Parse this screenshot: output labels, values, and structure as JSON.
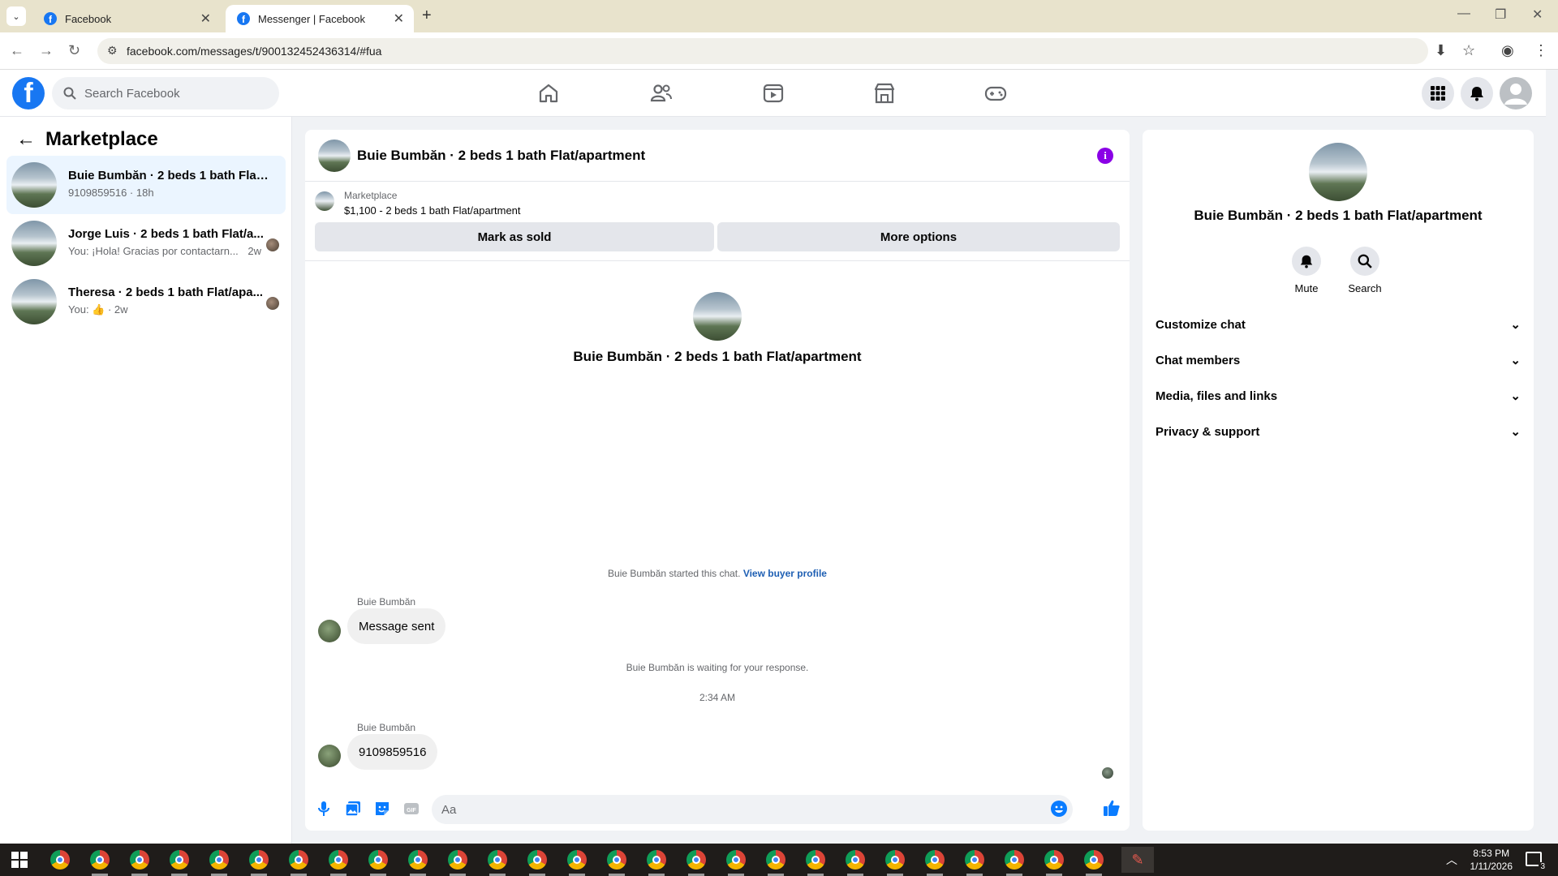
{
  "browser": {
    "tabs": [
      {
        "title": "Facebook",
        "active": false
      },
      {
        "title": "Messenger | Facebook",
        "active": true
      }
    ],
    "url": "facebook.com/messages/t/900132452436314/#fua"
  },
  "fb": {
    "logo": "f",
    "search_placeholder": "Search Facebook"
  },
  "sidebar": {
    "title": "Marketplace",
    "conversations": [
      {
        "name": "Buie Bumbăn · 2 beds 1 bath Flat/a...",
        "preview": "9109859516 · 18h",
        "active": true
      },
      {
        "name": "Jorge Luis · 2 beds 1 bath Flat/a...",
        "preview": "You: ¡Hola! Gracias por contactarn...",
        "time": "2w",
        "active": false
      },
      {
        "name": "Theresa · 2 beds 1 bath Flat/apa...",
        "preview": "You: ",
        "time": "· 2w",
        "active": false
      }
    ]
  },
  "chat": {
    "title": "Buie Bumbăn · 2 beds 1 bath Flat/apartment",
    "listing_label": "Marketplace",
    "listing_price": "$1,100 - 2 beds 1 bath Flat/apartment",
    "mark_sold_label": "Mark as sold",
    "more_options_label": "More options",
    "intro_name": "Buie Bumbăn · 2 beds 1 bath Flat/apartment",
    "started_text": "Buie Bumbăn started this chat.",
    "view_buyer_link": "View buyer profile",
    "messages": [
      {
        "sender": "Buie Bumbăn",
        "text": "Message sent"
      },
      {
        "sender": "Buie Bumbăn",
        "text": "9109859516"
      }
    ],
    "waiting_text": "Buie Bumbăn is waiting for your response.",
    "timestamp": "2:34 AM",
    "input_placeholder": "Aa"
  },
  "details": {
    "name": "Buie Bumbăn · 2 beds 1 bath Flat/apartment",
    "mute_label": "Mute",
    "search_label": "Search",
    "sections": [
      "Customize chat",
      "Chat members",
      "Media, files and links",
      "Privacy & support"
    ]
  },
  "taskbar": {
    "time": "8:53 PM",
    "date": "1/11/2026",
    "notification_count": "3"
  },
  "colors": {
    "brand": "#1877f2",
    "accent": "#8a00e6",
    "active_row": "#ebf5ff"
  }
}
